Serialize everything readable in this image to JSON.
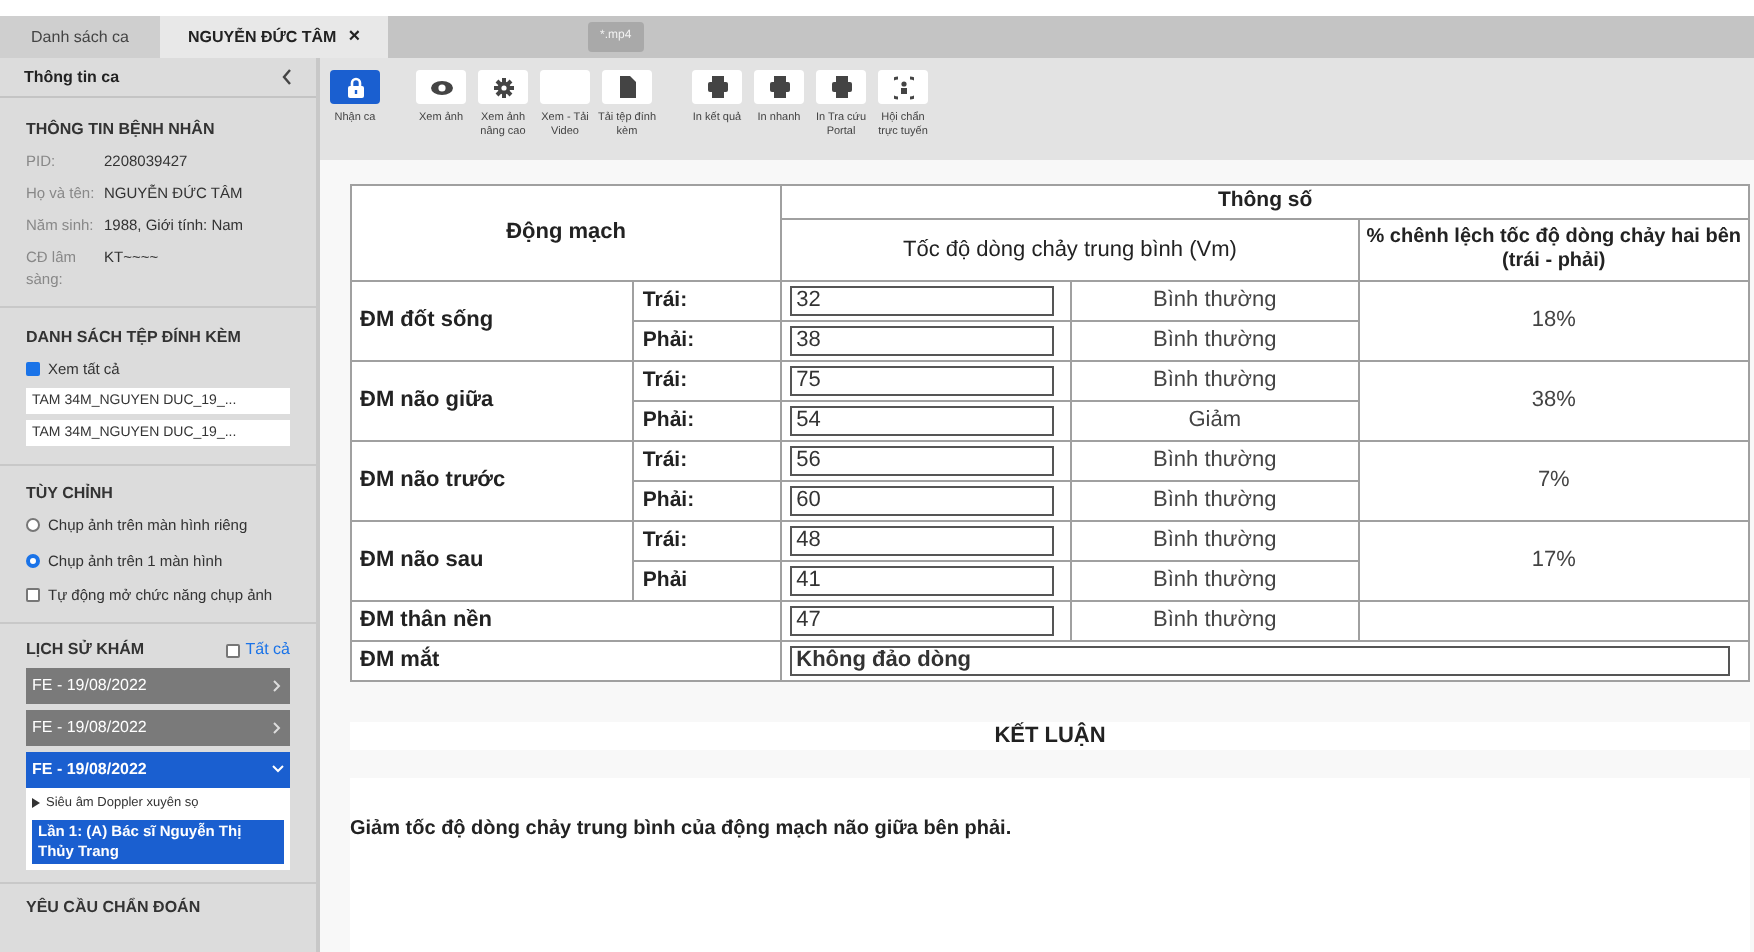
{
  "tabs": [
    {
      "label": "Danh sách ca",
      "selected": false
    },
    {
      "label": "NGUYỄN ĐỨC TÂM",
      "selected": true,
      "close": "×"
    }
  ],
  "media_chip": {
    "label": "*.mp4",
    "disabled": true
  },
  "sidebar": {
    "title": "Thông tin ca",
    "patient": {
      "title": "THÔNG TIN BỆNH NHÂN",
      "fields": [
        {
          "label": "PID:",
          "value": "2208039427"
        },
        {
          "label": "Họ và tên:",
          "value": "NGUYỄN ĐỨC TÂM"
        },
        {
          "label": "Năm sinh:",
          "value": "1988, Giới tính: Nam"
        },
        {
          "label": "CĐ lâm sàng:",
          "value": "KT~~~~"
        }
      ]
    },
    "attachments": {
      "title": "DANH SÁCH TỆP ĐÍNH KÈM",
      "view_all": {
        "label": "Xem tất cả",
        "checked": true
      },
      "files": [
        "TAM 34M_NGUYEN DUC_19_...",
        "TAM 34M_NGUYEN DUC_19_..."
      ]
    },
    "custom": {
      "title": "TÙY CHỈNH",
      "options": [
        {
          "kind": "radio",
          "label": "Chụp ảnh trên màn hình riêng",
          "checked": false
        },
        {
          "kind": "radio",
          "label": "Chụp ảnh trên 1 màn hình",
          "checked": true
        },
        {
          "kind": "checkbox",
          "label": "Tự động mở chức năng chụp ảnh",
          "checked": false
        }
      ]
    },
    "history": {
      "title": "LỊCH SỬ KHÁM",
      "all": {
        "label": "Tất cả",
        "checked": false
      },
      "visits": [
        {
          "label": "FE - 19/08/2022",
          "expanded": false
        },
        {
          "label": "FE - 19/08/2022",
          "expanded": false
        },
        {
          "label": "FE - 19/08/2022",
          "expanded": true,
          "children": [
            {
              "label": "Siêu âm Doppler xuyên sọ",
              "children": [
                {
                  "label": "Lần 1: (A) Bác sĩ Nguyễn Thị Thủy Trang",
                  "selected": true
                }
              ]
            }
          ]
        }
      ]
    },
    "next_section": {
      "title": "YÊU CẦU CHẨN ĐOÁN"
    }
  },
  "toolbar": {
    "groups": [
      [
        {
          "label": "Nhận ca",
          "active": true
        },
        {
          "label": "Xem ảnh",
          "active": false
        },
        {
          "label": "Xem ảnh nâng cao",
          "active": false
        },
        {
          "label": "Xem - Tải Video",
          "active": false
        },
        {
          "label": "Tải tệp đính kèm",
          "active": false
        }
      ],
      [
        {
          "label": "In kết quả",
          "active": false
        },
        {
          "label": "In nhanh",
          "active": false
        },
        {
          "label": "In Tra cứu Portal",
          "active": false
        },
        {
          "label": "Hội chẩn trực tuyến",
          "active": false
        }
      ]
    ]
  },
  "table": {
    "artery_header": "Động mạch",
    "params_header": "Thông số",
    "velocity_header": "Tốc độ dòng chảy trung bình (Vm)",
    "diff_header": "% chênh lệch tốc độ dòng chảy hai bên (trái - phải)",
    "rows": [
      {
        "kind": "paired",
        "name": "ĐM đốt sống",
        "sides": [
          {
            "side": "Trái:",
            "value": "32",
            "status": "Bình thường"
          },
          {
            "side": "Phải:",
            "value": "38",
            "status": "Bình thường"
          }
        ],
        "diff": "18%"
      },
      {
        "kind": "paired",
        "name": "ĐM não giữa",
        "sides": [
          {
            "side": "Trái:",
            "value": "75",
            "status": "Bình thường"
          },
          {
            "side": "Phải:",
            "value": "54",
            "status": "Giảm"
          }
        ],
        "diff": "38%"
      },
      {
        "kind": "paired",
        "name": "ĐM não trước",
        "sides": [
          {
            "side": "Trái:",
            "value": "56",
            "status": "Bình thường"
          },
          {
            "side": "Phải:",
            "value": "60",
            "status": "Bình thường"
          }
        ],
        "diff": "7%"
      },
      {
        "kind": "paired",
        "name": "ĐM não sau",
        "sides": [
          {
            "side": "Trái:",
            "value": "48",
            "status": "Bình thường"
          },
          {
            "side": "Phải",
            "value": "41",
            "status": "Bình thường"
          }
        ],
        "diff": "17%"
      },
      {
        "kind": "single",
        "name": "ĐM thân nền",
        "value": "47",
        "status": "Bình thường"
      },
      {
        "kind": "wide",
        "name": "ĐM mắt",
        "value": "Không đảo dòng"
      }
    ]
  },
  "conclusion": {
    "title": "KẾT LUẬN",
    "text": "Giảm tốc độ dòng chảy trung bình của động mạch não giữa bên phải."
  }
}
